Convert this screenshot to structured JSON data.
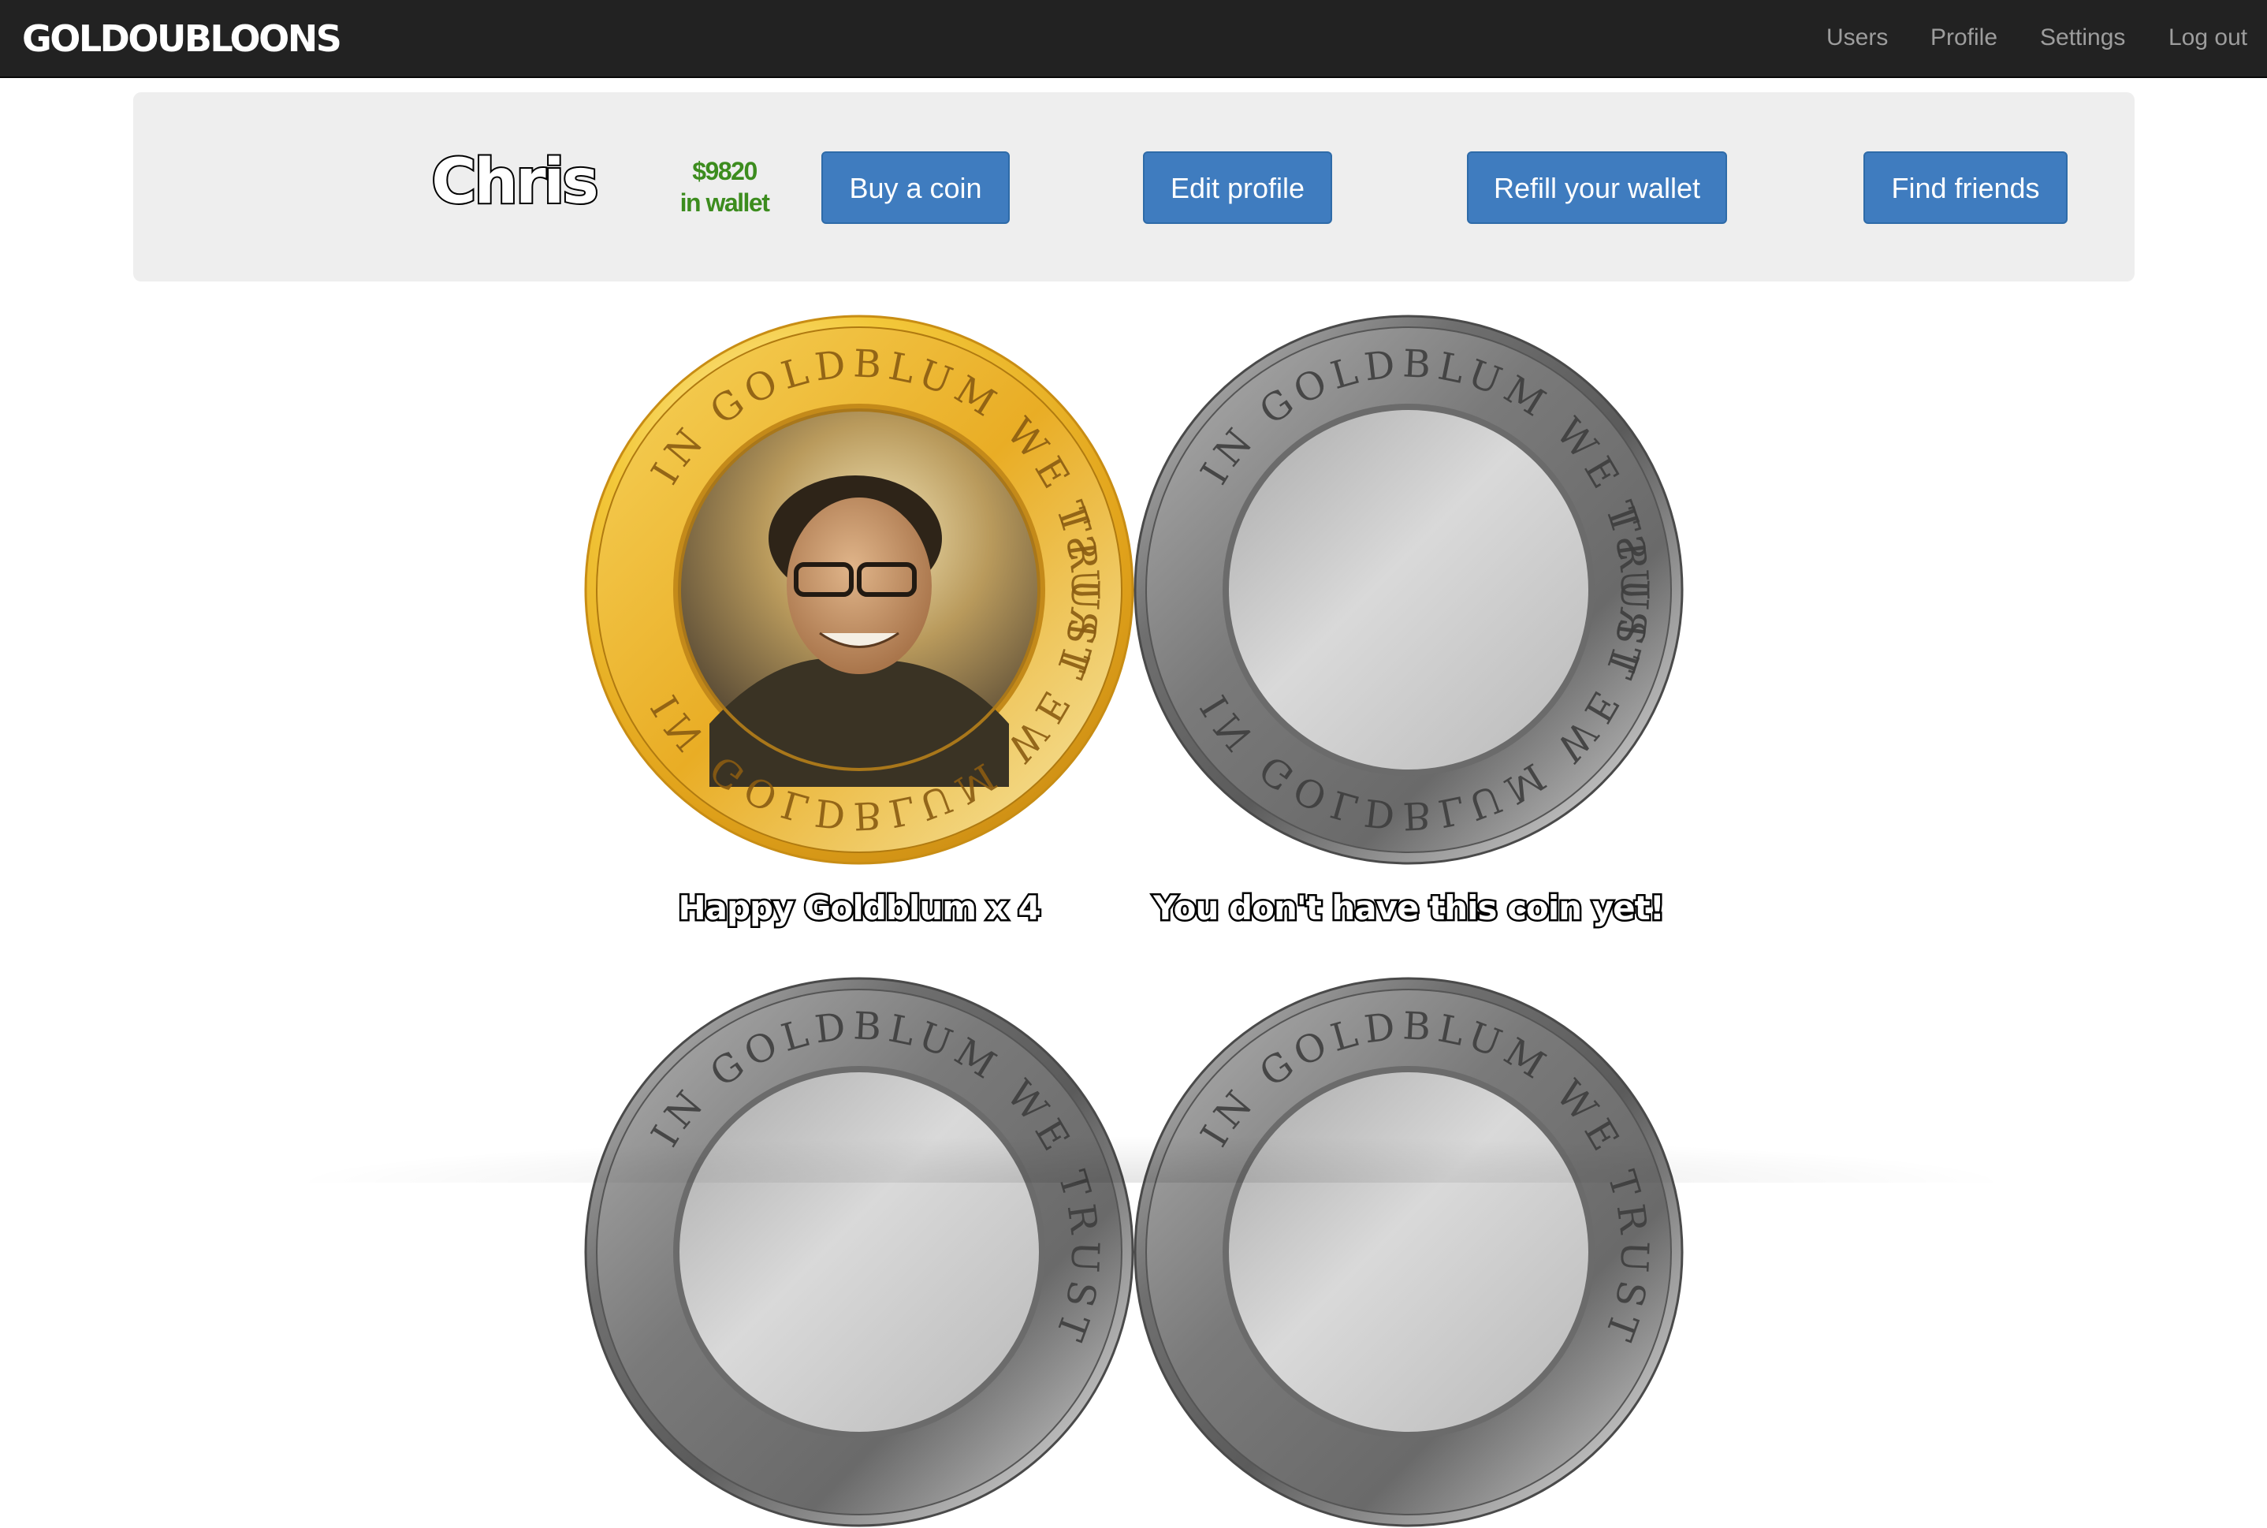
{
  "navbar": {
    "brand": "GOLDOUBLOONS",
    "links": [
      "Users",
      "Profile",
      "Settings",
      "Log out"
    ]
  },
  "profile": {
    "name": "Chris",
    "wallet_amount": "$9820",
    "wallet_label": "in wallet"
  },
  "actions": {
    "buy": "Buy a coin",
    "edit": "Edit profile",
    "refill": "Refill your wallet",
    "friends": "Find friends"
  },
  "coins": [
    {
      "inscription": "IN GOLDBLUM WE TRUST",
      "caption": "Happy Goldblum x 4",
      "owned": true
    },
    {
      "inscription": "IN GOLDBLUM WE TRUST",
      "caption": "You don't have this coin yet!",
      "owned": false
    },
    {
      "inscription": "IN GOLDBLUM WE TRUST",
      "caption": "",
      "owned": false
    },
    {
      "inscription": "IN GOLDBLUM WE TRUST",
      "caption": "",
      "owned": false
    }
  ],
  "colors": {
    "navbar_bg": "#222222",
    "nav_link": "#9d9d9d",
    "jumbotron_bg": "#eeeeee",
    "button_bg": "#3f7cbf",
    "wallet_text": "#3c8c1e",
    "gold": "#e8a919",
    "silver": "#8a8a8a"
  }
}
